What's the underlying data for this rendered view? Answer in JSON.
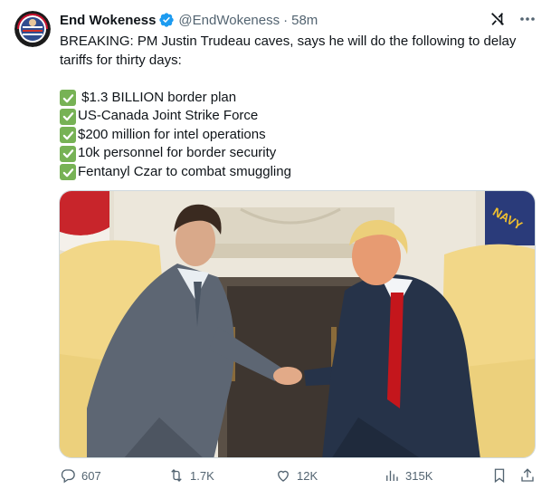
{
  "author": {
    "name": "End Wokeness",
    "handle": "@EndWokeness",
    "separator": "·",
    "time": "58m",
    "verified": true
  },
  "tweet": {
    "lead": "BREAKING: PM Justin Trudeau caves, says he will do the following to delay tariffs for thirty days:",
    "items": [
      {
        "text": " $1.3 BILLION border plan"
      },
      {
        "text": "US-Canada Joint Strike Force"
      },
      {
        "text": "$200 million for intel operations"
      },
      {
        "text": "10k personnel for border security"
      },
      {
        "text": "Fentanyl Czar to combat smuggling"
      }
    ]
  },
  "media": {
    "flag_text": "NAVY"
  },
  "metrics": {
    "replies": "607",
    "reposts": "1.7K",
    "likes": "12K",
    "views": "315K"
  },
  "icons": {
    "avatar": "end-wokeness-logo",
    "verified": "verified-badge-icon",
    "grok": "grok-icon",
    "more": "more-icon",
    "check": "check-mark-icon",
    "reply": "reply-icon",
    "repost": "repost-icon",
    "like": "heart-icon",
    "views": "views-icon",
    "bookmark": "bookmark-icon",
    "share": "share-icon"
  },
  "colors": {
    "text": "#0f1419",
    "muted": "#536471",
    "verified_blue": "#1d9bf0",
    "check_green": "#77b255"
  }
}
